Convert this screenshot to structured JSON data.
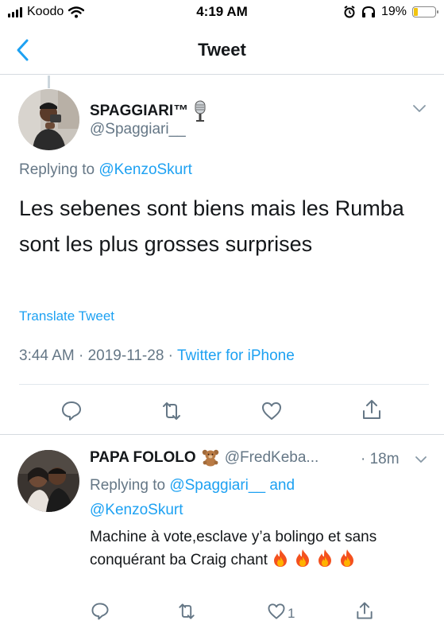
{
  "status_bar": {
    "carrier": "Koodo",
    "time": "4:19 AM",
    "battery": "19%",
    "battery_level": 0.19
  },
  "nav": {
    "title": "Tweet",
    "back_icon": "chevron-left-icon"
  },
  "main_tweet": {
    "display_name": "SPAGGIARI™",
    "name_emoji": "microphone-emoji",
    "handle": "@Spaggiari__",
    "replying_prefix": "Replying to",
    "replying_to": "@KenzoSkurt",
    "text": "Les sebenes sont biens mais les Rumba sont les plus grosses surprises",
    "translate_label": "Translate Tweet",
    "time": "3:44 AM",
    "date": "2019-11-28",
    "source": "Twitter for iPhone",
    "separator": "·"
  },
  "reply_tweet": {
    "display_name": "PAPA FOLOLO",
    "name_emoji": "teddy-bear-emoji",
    "handle": "@FredKeba...",
    "time": "· 18m",
    "replying_prefix": "Replying to",
    "replying_to_1": "@Spaggiari__",
    "replying_and": "and",
    "replying_to_2": "@KenzoSkurt",
    "text": "Machine à vote,esclave y’a bolingo et sans conquérant ba Craig chant",
    "fire_count": 4,
    "like_count": "1"
  },
  "colors": {
    "accent": "#1da1f2",
    "text": "#14171a",
    "secondary": "#657786",
    "divider": "#e1e8ed"
  }
}
